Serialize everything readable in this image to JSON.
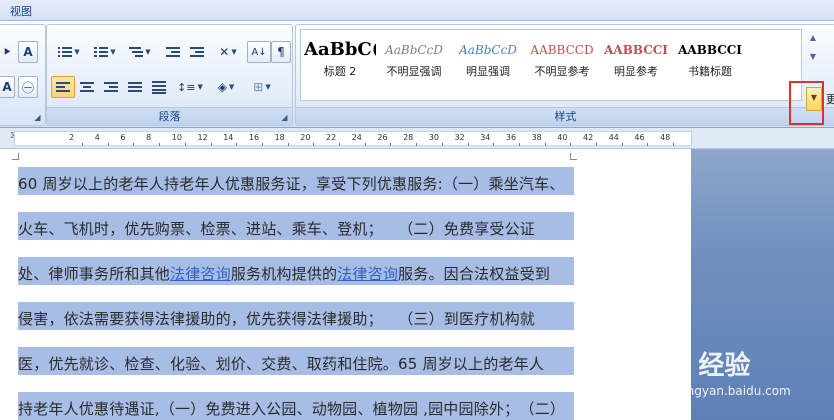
{
  "tabs": {
    "view": "视图"
  },
  "paragraph_group": {
    "label": "段落"
  },
  "styles_group": {
    "label": "样式",
    "tiles": [
      {
        "sample": "AaBbC(",
        "name": "标题 2",
        "color": "#000000"
      },
      {
        "sample": "AaBbCcD",
        "name": "不明显强调",
        "color": "#808080"
      },
      {
        "sample": "AaBbCcD",
        "name": "明显强调",
        "color": "#4f81bd"
      },
      {
        "sample": "AABBCCD",
        "name": "不明显参考",
        "color": "#c0504d"
      },
      {
        "sample": "AABBCCI",
        "name": "明显参考",
        "color": "#c0504d"
      },
      {
        "sample": "AABBCCI",
        "name": "书籍标题",
        "color": "#000000"
      }
    ],
    "edge_label": "更"
  },
  "ruler": {
    "numbers": [
      "2",
      "4",
      "6",
      "8",
      "10",
      "12",
      "14",
      "16",
      "18",
      "20",
      "22",
      "24",
      "26",
      "28",
      "30",
      "32",
      "34",
      "36",
      "38",
      "40",
      "42",
      "44",
      "46",
      "48"
    ]
  },
  "document": {
    "lines": [
      [
        {
          "t": "60 周岁以上的老年人持老年人优惠服务证，享受下列优惠服务:（一）乘坐汽车、"
        }
      ],
      [
        {
          "t": "火车、飞机时，优先购票、检票、进站、乘车、登机；　　（二）免费享受公证"
        }
      ],
      [
        {
          "t": "处、律师事务所和其他"
        },
        {
          "t": "法律咨询",
          "link": true
        },
        {
          "t": "服务机构提供的"
        },
        {
          "t": "法律咨询",
          "link": true
        },
        {
          "t": "服务。因合法权益受到"
        }
      ],
      [
        {
          "t": "侵害，依法需要获得法律援助的，优先获得法律援助；　　（三）到医疗机构就"
        }
      ],
      [
        {
          "t": "医，优先就诊、检查、化验、划价、交费、取药和住院。65 周岁以上的老年人"
        }
      ],
      [
        {
          "t": "持老年人优惠待遇证,（一）免费进入公园、动物园、植物园 ,园中园除外；　（二）"
        }
      ]
    ]
  },
  "watermark": {
    "brand": "Bai 经验",
    "url": "jingyan.baidu.com"
  }
}
